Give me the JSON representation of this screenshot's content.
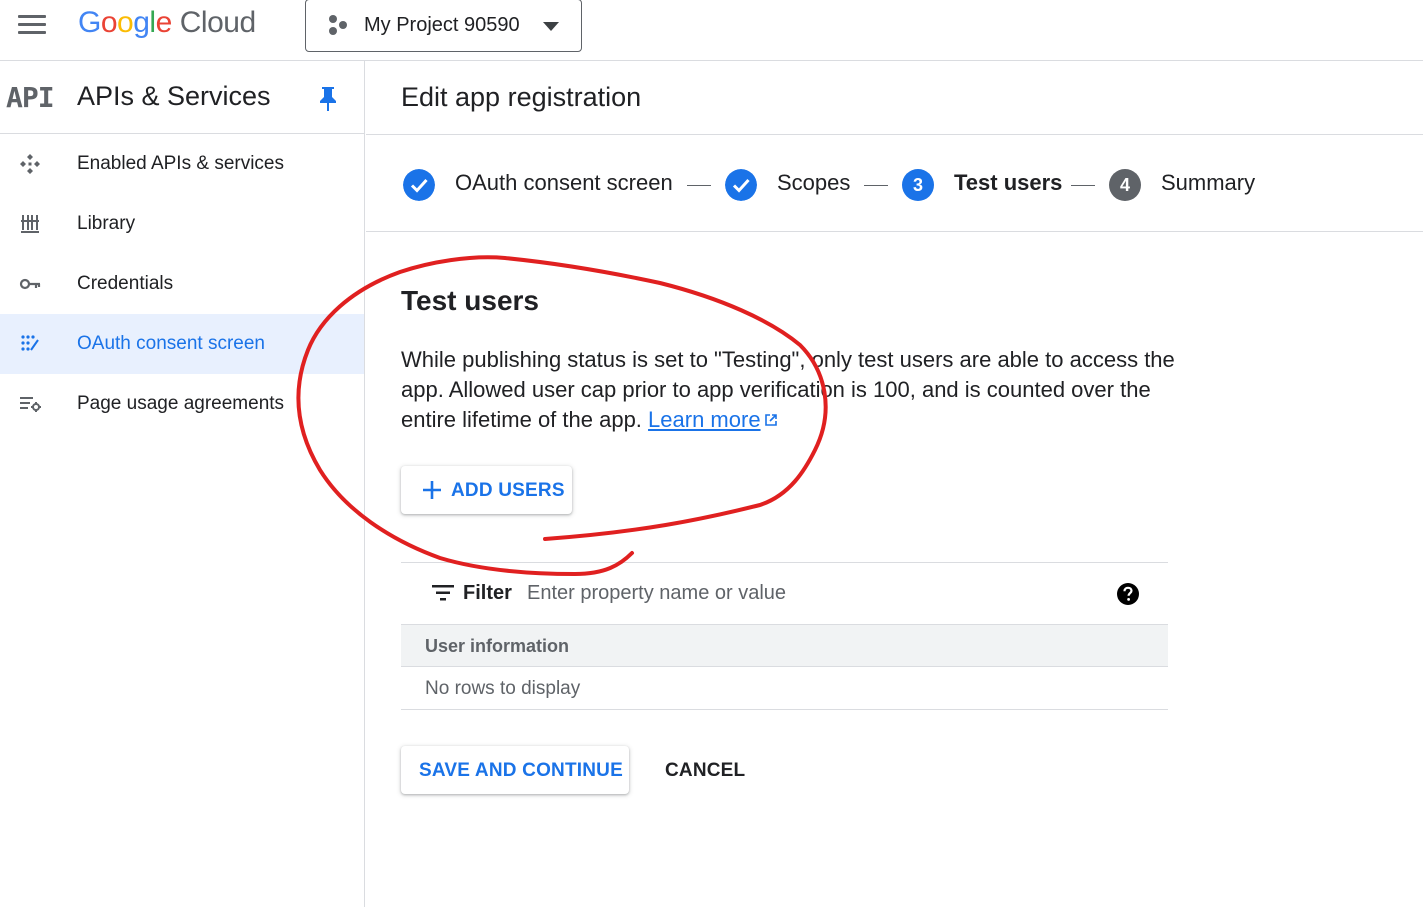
{
  "topbar": {
    "menu_icon": "hamburger-menu-icon",
    "logo_letters": [
      "G",
      "o",
      "o",
      "g",
      "l",
      "e"
    ],
    "logo_suffix": "Cloud",
    "project_name": "My Project 90590"
  },
  "sidebar": {
    "badge": "API",
    "title": "APIs & Services",
    "items": [
      {
        "label": "Enabled APIs & services",
        "icon": "enabled-apis-icon",
        "active": false
      },
      {
        "label": "Library",
        "icon": "library-icon",
        "active": false
      },
      {
        "label": "Credentials",
        "icon": "key-icon",
        "active": false
      },
      {
        "label": "OAuth consent screen",
        "icon": "oauth-icon",
        "active": true
      },
      {
        "label": "Page usage agreements",
        "icon": "settings-list-icon",
        "active": false
      }
    ]
  },
  "main": {
    "title": "Edit app registration",
    "steps": [
      {
        "label": "OAuth consent screen",
        "state": "done"
      },
      {
        "label": "Scopes",
        "state": "done"
      },
      {
        "number": "3",
        "label": "Test users",
        "state": "current"
      },
      {
        "number": "4",
        "label": "Summary",
        "state": "pending"
      }
    ],
    "section_title": "Test users",
    "description": "While publishing status is set to \"Testing\", only test users are able to access the app. Allowed user cap prior to app verification is 100, and is counted over the entire lifetime of the app.",
    "learn_more": "Learn more",
    "add_users_label": "ADD USERS",
    "filter": {
      "label": "Filter",
      "placeholder": "Enter property name or value"
    },
    "table": {
      "column_header": "User information",
      "empty_message": "No rows to display"
    },
    "save_label": "SAVE AND CONTINUE",
    "cancel_label": "CANCEL"
  },
  "colors": {
    "accent": "#1a73e8",
    "active_nav_bg": "#e8f0fe",
    "annotation": "#e02020"
  }
}
